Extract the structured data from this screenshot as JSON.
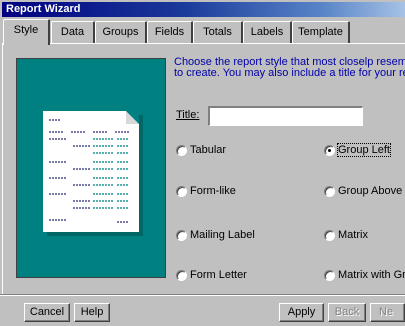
{
  "window": {
    "title": "Report Wizard"
  },
  "tabs": [
    {
      "label": "Style",
      "active": true
    },
    {
      "label": "Data"
    },
    {
      "label": "Groups"
    },
    {
      "label": "Fields"
    },
    {
      "label": "Totals"
    },
    {
      "label": "Labels"
    },
    {
      "label": "Template"
    }
  ],
  "style_page": {
    "instructions_line1": "Choose the report style that most closelp resembles the r",
    "instructions_line2": "to create. You may also include a title for your report.",
    "title_label": "Title:",
    "title_value": "",
    "styles": [
      {
        "label": "Tabular",
        "checked": false
      },
      {
        "label": "Group Left",
        "checked": true
      },
      {
        "label": "Form-like",
        "checked": false
      },
      {
        "label": "Group Above",
        "checked": false
      },
      {
        "label": "Mailing Label",
        "checked": false
      },
      {
        "label": "Matrix",
        "checked": false
      },
      {
        "label": "Form Letter",
        "checked": false
      },
      {
        "label": "Matrix with Gr",
        "checked": false
      }
    ],
    "preview_colors": {
      "background": "#008080",
      "paper": "#ffffff"
    }
  },
  "buttons": {
    "cancel": "Cancel",
    "help": "Help",
    "apply": "Apply",
    "back": "Back",
    "next": "Ne"
  }
}
